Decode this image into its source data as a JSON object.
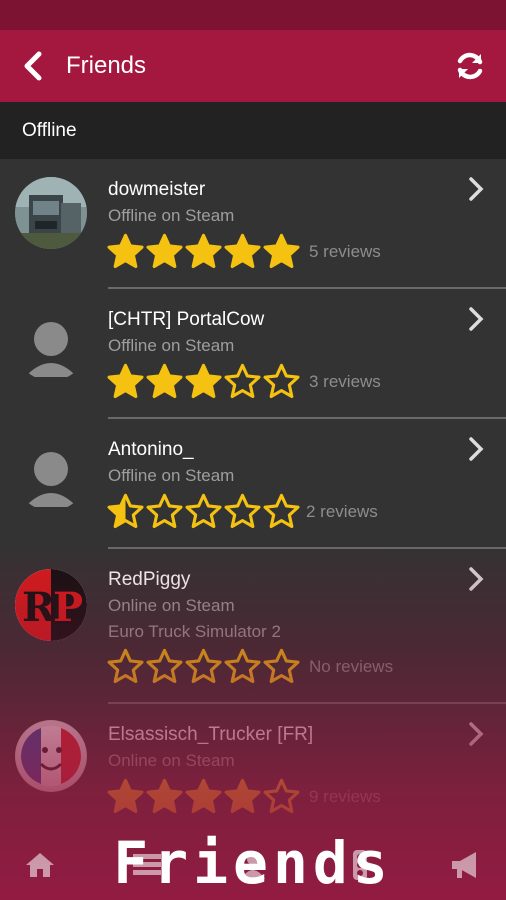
{
  "app": {
    "title": "Friends"
  },
  "section": {
    "label": "Offline"
  },
  "friends": [
    {
      "name": "dowmeister",
      "status": "Offline on Steam",
      "game": "",
      "rating": 5,
      "reviews": "5 reviews",
      "avatar": "truck-photo"
    },
    {
      "name": "[CHTR] PortalCow",
      "status": "Offline on Steam",
      "game": "",
      "rating": 3,
      "reviews": "3 reviews",
      "avatar": "default-person"
    },
    {
      "name": "Antonino_",
      "status": "Offline on Steam",
      "game": "",
      "rating": 0.5,
      "reviews": "2 reviews",
      "avatar": "default-person"
    },
    {
      "name": "RedPiggy",
      "status": "Online on Steam",
      "game": "Euro Truck Simulator 2",
      "rating": 0,
      "reviews": "No reviews",
      "avatar": "rp-logo"
    },
    {
      "name": "Elsassisch_Trucker [FR]",
      "status": "Online on Steam",
      "game": "",
      "rating": 4,
      "reviews": "9 reviews",
      "avatar": "french-flag-face"
    }
  ],
  "bottom_nav": [
    "home-icon",
    "list-icon",
    "friends-icon",
    "traffic-light-icon",
    "megaphone-icon"
  ],
  "promo": {
    "text": "Friends"
  },
  "colors": {
    "appbar": "#a4173f",
    "statusbar": "#7d1333",
    "star": "#f5c211",
    "background": "#333333",
    "section": "#222222"
  }
}
